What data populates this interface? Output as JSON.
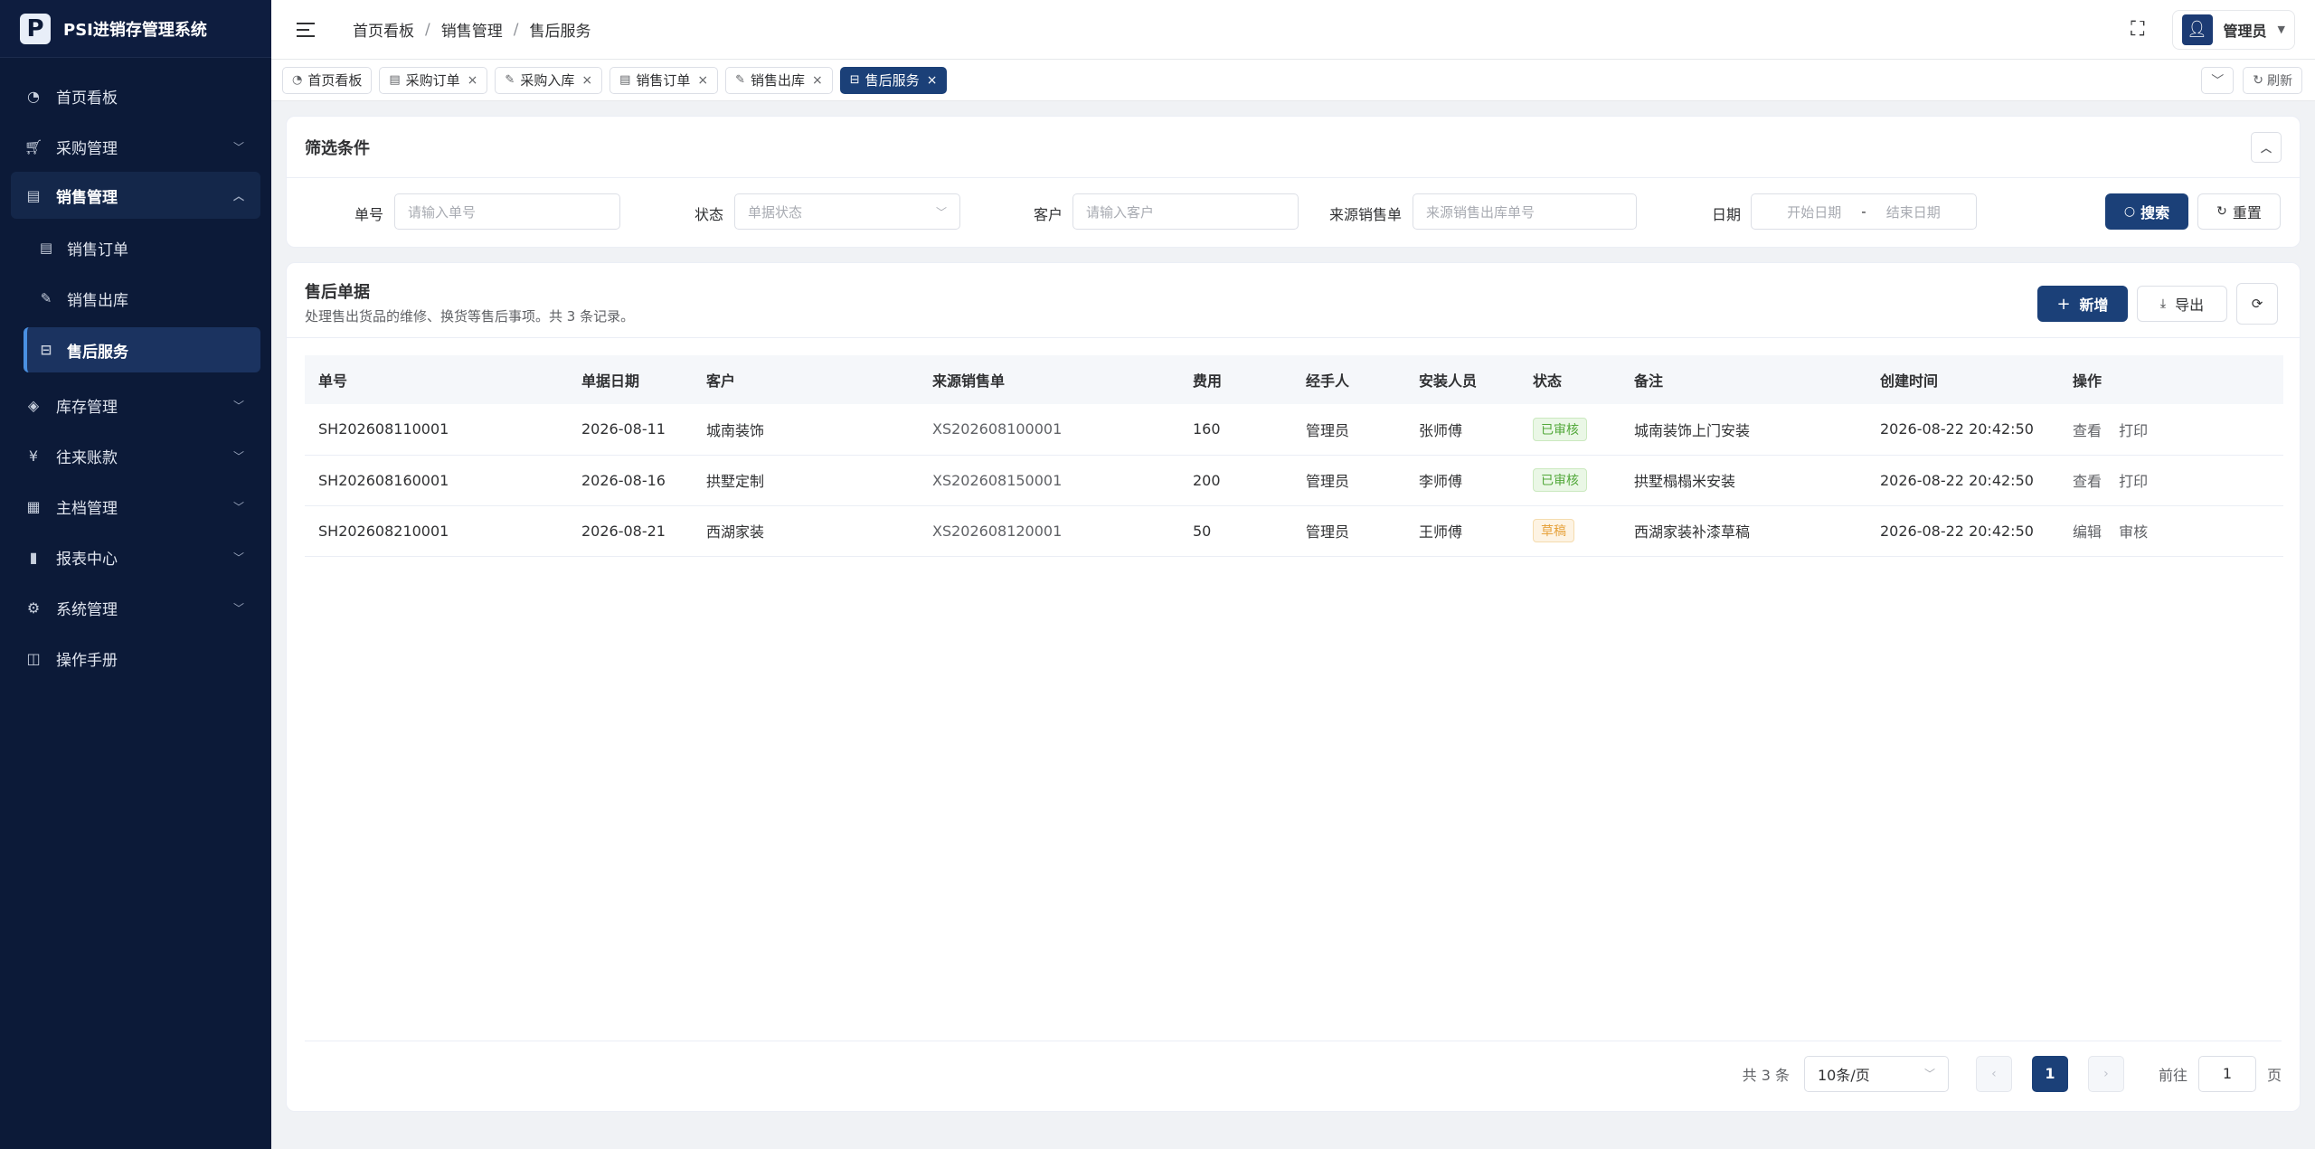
{
  "app": {
    "logo_letter": "P",
    "title": "PSI进销存管理系统"
  },
  "sidebar": {
    "items": [
      {
        "label": "首页看板",
        "icon": "dashboard-icon"
      },
      {
        "label": "采购管理",
        "icon": "cart-icon"
      },
      {
        "label": "销售管理",
        "icon": "sales-icon"
      },
      {
        "label": "库存管理",
        "icon": "layers-icon"
      },
      {
        "label": "往来账款",
        "icon": "yen-icon"
      },
      {
        "label": "主档管理",
        "icon": "database-icon"
      },
      {
        "label": "报表中心",
        "icon": "bar-chart-icon"
      },
      {
        "label": "系统管理",
        "icon": "gear-icon"
      },
      {
        "label": "操作手册",
        "icon": "book-icon"
      }
    ],
    "sales_sub": [
      {
        "label": "销售订单"
      },
      {
        "label": "销售出库"
      },
      {
        "label": "售后服务"
      }
    ]
  },
  "header": {
    "breadcrumb": [
      "首页看板",
      "销售管理",
      "售后服务"
    ],
    "user_name": "管理员"
  },
  "tabs": {
    "items": [
      "首页看板",
      "采购订单",
      "采购入库",
      "销售订单",
      "销售出库",
      "售后服务"
    ],
    "refresh_label": "刷新"
  },
  "filter": {
    "title": "筛选条件",
    "order_no_label": "单号",
    "order_no_placeholder": "请输入单号",
    "status_label": "状态",
    "status_placeholder": "单据状态",
    "customer_label": "客户",
    "customer_placeholder": "请输入客户",
    "source_label": "来源销售单",
    "source_placeholder": "来源销售出库单号",
    "date_label": "日期",
    "date_start_placeholder": "开始日期",
    "date_sep": "-",
    "date_end_placeholder": "结束日期",
    "search_label": "搜索",
    "reset_label": "重置"
  },
  "table": {
    "title": "售后单据",
    "subtitle": "处理售出货品的维修、换货等售后事项。共 3 条记录。",
    "add_label": "新增",
    "export_label": "导出",
    "columns": [
      "单号",
      "单据日期",
      "客户",
      "来源销售单",
      "费用",
      "经手人",
      "安装人员",
      "状态",
      "备注",
      "创建时间",
      "操作"
    ],
    "rows": [
      {
        "no": "SH202608110001",
        "date": "2026-08-11",
        "customer": "城南装饰",
        "source": "XS202608100001",
        "fee": "160",
        "handler": "管理员",
        "installer": "张师傅",
        "status": "已审核",
        "status_type": "approved",
        "remark": "城南装饰上门安装",
        "created": "2026-08-22 20:42:50",
        "op1": "查看",
        "op2": "打印"
      },
      {
        "no": "SH202608160001",
        "date": "2026-08-16",
        "customer": "拱墅定制",
        "source": "XS202608150001",
        "fee": "200",
        "handler": "管理员",
        "installer": "李师傅",
        "status": "已审核",
        "status_type": "approved",
        "remark": "拱墅榻榻米安装",
        "created": "2026-08-22 20:42:50",
        "op1": "查看",
        "op2": "打印"
      },
      {
        "no": "SH202608210001",
        "date": "2026-08-21",
        "customer": "西湖家装",
        "source": "XS202608120001",
        "fee": "50",
        "handler": "管理员",
        "installer": "王师傅",
        "status": "草稿",
        "status_type": "draft",
        "remark": "西湖家装补漆草稿",
        "created": "2026-08-22 20:42:50",
        "op1": "编辑",
        "op2": "审核"
      }
    ]
  },
  "pager": {
    "total": "共 3 条",
    "page_size": "10条/页",
    "current": "1",
    "goto_label": "前往",
    "goto_value": "1",
    "page_suffix": "页"
  },
  "colors": {
    "primary": "#1b4078",
    "sidebar_bg": "#0c1a38",
    "approved": "#52a83a",
    "draft": "#e6a23c"
  }
}
